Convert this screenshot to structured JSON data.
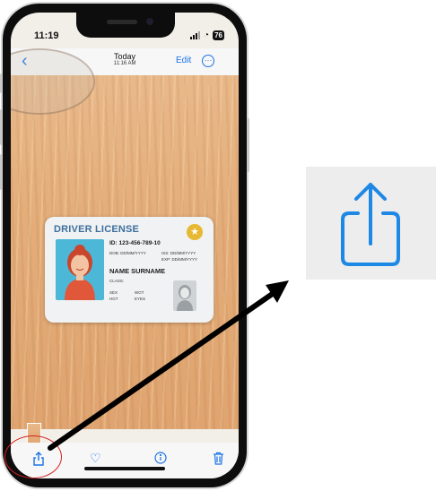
{
  "status_bar": {
    "time": "11:19",
    "battery": "76"
  },
  "nav": {
    "back_icon": "chevron-left-icon",
    "title": "Today",
    "subtitle": "11:16 AM",
    "edit_label": "Edit",
    "more_icon": "ellipsis-circle-icon"
  },
  "card": {
    "title": "DRIVER LICENSE",
    "id_line": "ID: 123-456-789-10",
    "dob": "DOB: DD/MM/YYYY",
    "iss": "ISS: DD/MM/YYYY",
    "exp": "EXP: DD/MM/YYYY",
    "name": "NAME SURNAME",
    "class_label": "CLASS:",
    "sex_label": "SEX",
    "wgt_label": "WGT",
    "hgt_label": "HGT",
    "eyes_label": "EYES"
  },
  "toolbar": {
    "share_icon": "share-icon",
    "favorite_icon": "heart-icon",
    "info_icon": "info-icon",
    "delete_icon": "trash-icon"
  },
  "colors": {
    "accent": "#1a73e8",
    "highlight": "#d42020",
    "card_title": "#3d6f9e",
    "table_wood": "#e3ac78"
  }
}
